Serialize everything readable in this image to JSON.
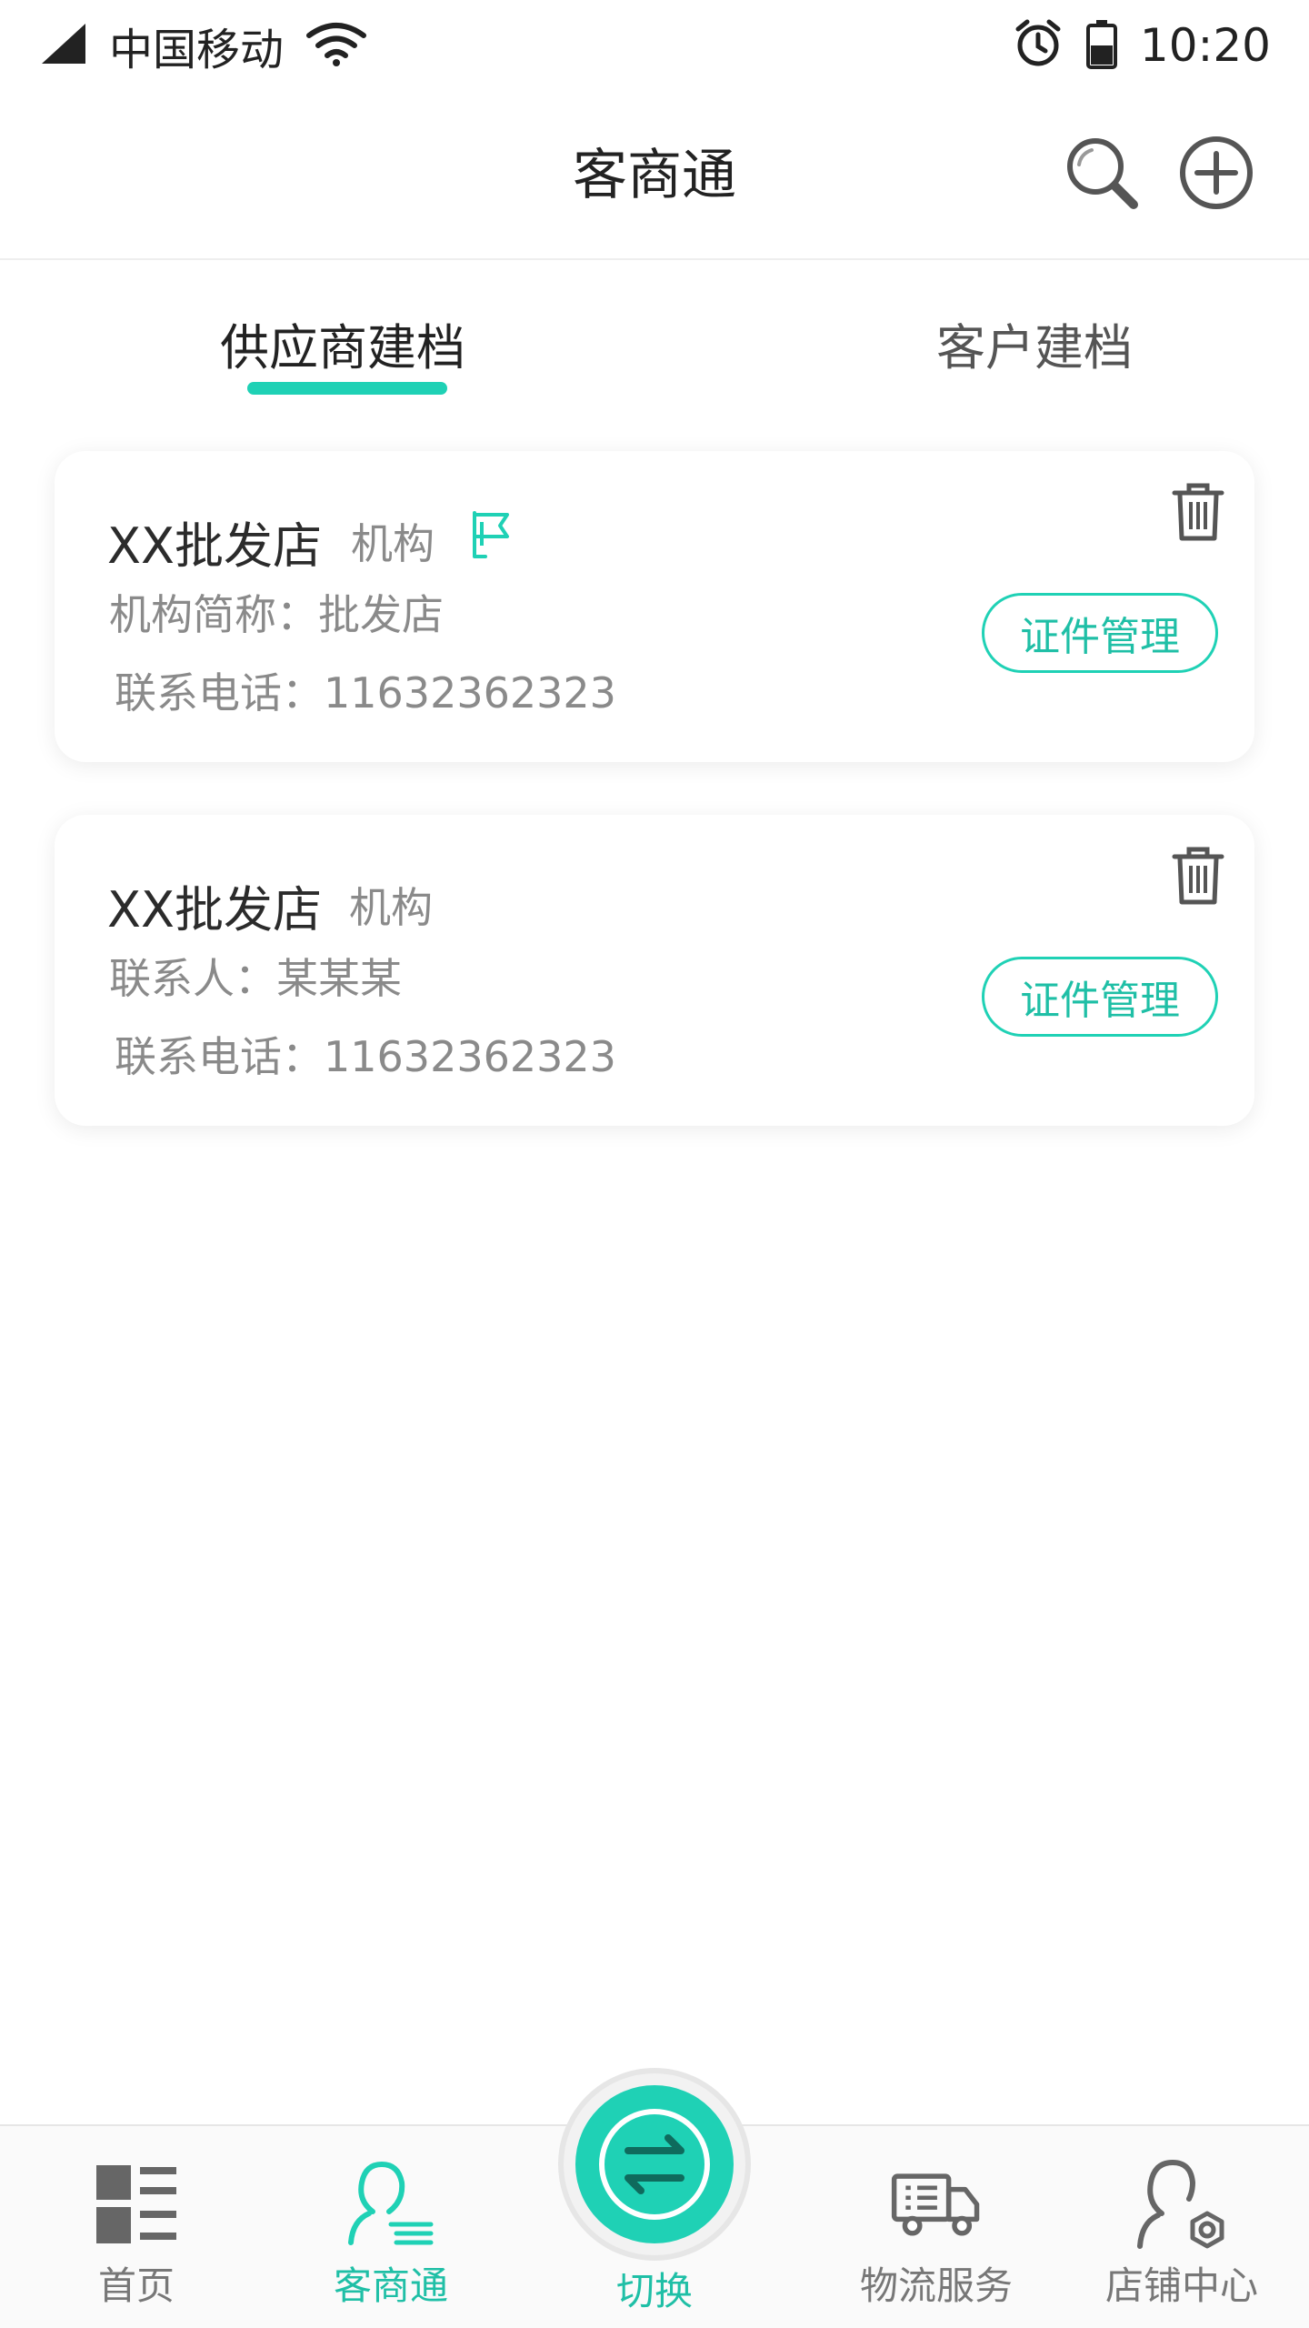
{
  "status_bar": {
    "carrier": "中国移动",
    "time": "10:20",
    "icons": [
      "signal-icon",
      "wifi-icon",
      "alarm-icon",
      "battery-icon"
    ]
  },
  "header": {
    "title": "客商通",
    "actions": [
      "search-icon",
      "add-icon"
    ]
  },
  "tabs": [
    {
      "label": "供应商建档",
      "active": true
    },
    {
      "label": "客户建档",
      "active": false
    }
  ],
  "cards": [
    {
      "name": "XX批发店",
      "type": "机构",
      "flag_icon": "flag-icon",
      "line1": "机构简称：批发店",
      "line2": "联系电话：11632362323",
      "button": "证件管理"
    },
    {
      "name": "XX批发店",
      "type": "机构",
      "line1": "联系人：某某某",
      "line2": "联系电话：11632362323",
      "button": "证件管理"
    }
  ],
  "bottom_nav": [
    {
      "label": "首页",
      "icon": "dashboard-icon",
      "active": false
    },
    {
      "label": "客商通",
      "icon": "contact-icon",
      "active": true
    },
    {
      "label": "切换",
      "icon": "switch-icon",
      "active": false
    },
    {
      "label": "物流服务",
      "icon": "truck-icon",
      "active": false
    },
    {
      "label": "店铺中心",
      "icon": "store-user-icon",
      "active": false
    }
  ],
  "colors": {
    "accent": "#1fd1b5",
    "accent_text": "#1fbfa6",
    "text_primary": "#222222",
    "text_secondary": "#8a8a8a"
  }
}
